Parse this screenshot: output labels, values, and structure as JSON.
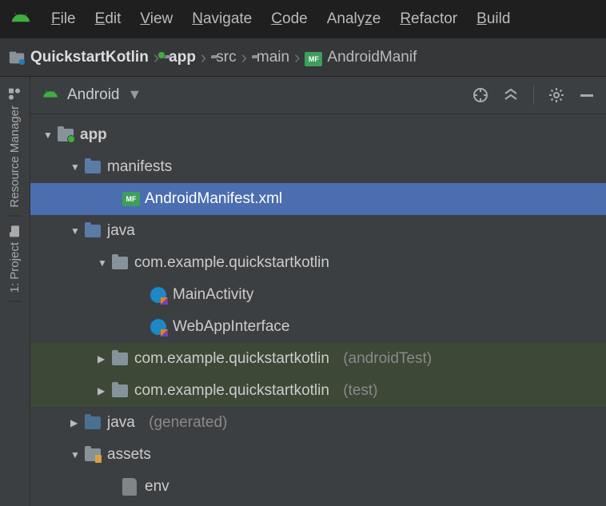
{
  "menu": {
    "items": [
      {
        "pre": "",
        "u": "F",
        "post": "ile"
      },
      {
        "pre": "",
        "u": "E",
        "post": "dit"
      },
      {
        "pre": "",
        "u": "V",
        "post": "iew"
      },
      {
        "pre": "",
        "u": "N",
        "post": "avigate"
      },
      {
        "pre": "",
        "u": "C",
        "post": "ode"
      },
      {
        "pre": "Analy",
        "u": "z",
        "post": "e"
      },
      {
        "pre": "",
        "u": "R",
        "post": "efactor"
      },
      {
        "pre": "",
        "u": "B",
        "post": "uild"
      }
    ]
  },
  "breadcrumb": {
    "items": [
      {
        "label": "QuickstartKotlin",
        "bold": true,
        "icon": "project"
      },
      {
        "label": "app",
        "bold": true,
        "icon": "module"
      },
      {
        "label": "src",
        "bold": false,
        "icon": "folder"
      },
      {
        "label": "main",
        "bold": false,
        "icon": "folder"
      },
      {
        "label": "AndroidManif",
        "bold": false,
        "icon": "manifest"
      }
    ]
  },
  "tool_tabs": [
    {
      "label": "Resource Manager"
    },
    {
      "label": "1: Project"
    }
  ],
  "pane": {
    "selector": "Android"
  },
  "tree": {
    "r0": {
      "label": "app"
    },
    "r1": {
      "label": "manifests"
    },
    "r2": {
      "label": "AndroidManifest.xml"
    },
    "r3": {
      "label": "java"
    },
    "r4": {
      "label": "com.example.quickstartkotlin"
    },
    "r5": {
      "label": "MainActivity"
    },
    "r6": {
      "label": "WebAppInterface"
    },
    "r7": {
      "label": "com.example.quickstartkotlin",
      "hint": "(androidTest)"
    },
    "r8": {
      "label": "com.example.quickstartkotlin",
      "hint": "(test)"
    },
    "r9": {
      "label": "java",
      "hint": "(generated)"
    },
    "r10": {
      "label": "assets"
    },
    "r11": {
      "label": "env"
    }
  }
}
